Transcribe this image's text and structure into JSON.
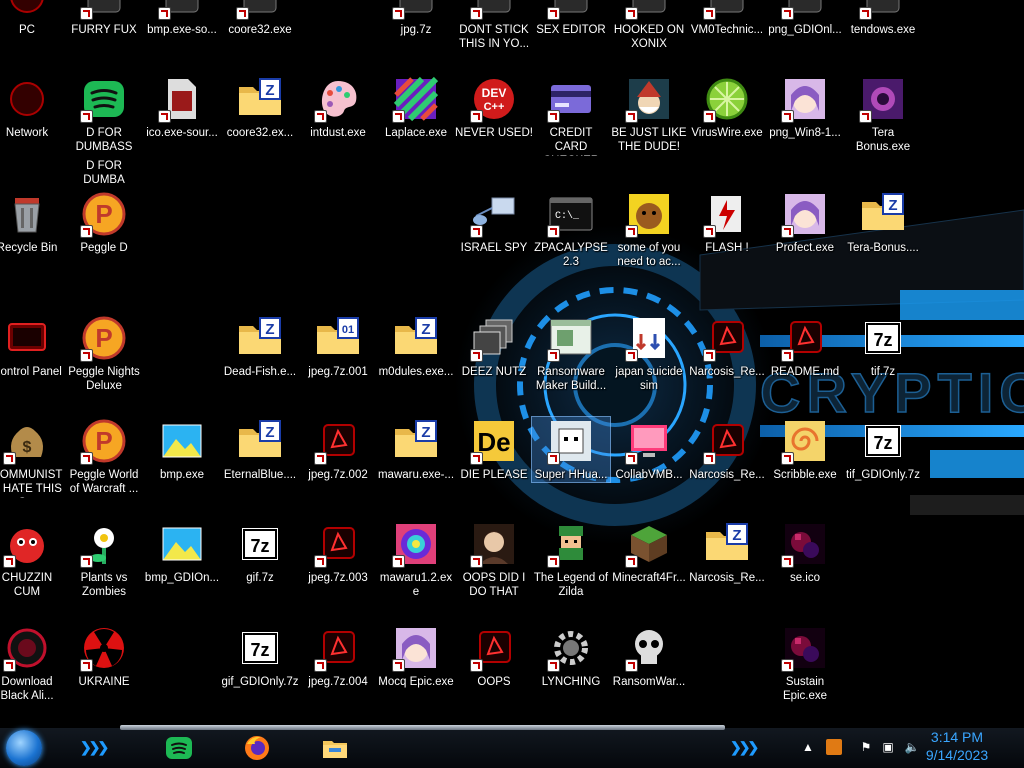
{
  "wallpaper": {
    "logo_text": "CRYPTIC"
  },
  "taskbar": {
    "start_label": "Start",
    "clock_time": "3:14 PM",
    "clock_date": "9/14/2023",
    "pinned": [
      "Spotify",
      "Firefox",
      "File Explorer"
    ]
  },
  "icons": [
    {
      "label": "PC",
      "icon": "computer-icon"
    },
    {
      "label": "FURRY FUX",
      "icon": "app-icon"
    },
    {
      "label": "bmp.exe-so...",
      "icon": "app-icon"
    },
    {
      "label": "coore32.exe",
      "icon": "app-icon"
    },
    {
      "label": "jpg.7z",
      "icon": "archive-icon"
    },
    {
      "label": "DONT STICK THIS IN YO...",
      "icon": "app-icon"
    },
    {
      "label": "SEX EDITOR",
      "icon": "app-icon"
    },
    {
      "label": "HOOKED ON XONIX",
      "icon": "app-icon"
    },
    {
      "label": "VM0Technic...",
      "icon": "app-icon"
    },
    {
      "label": "png_GDIOnl...",
      "icon": "app-icon"
    },
    {
      "label": "tendows.exe",
      "icon": "app-icon"
    },
    {
      "label": "Network",
      "icon": "network-icon"
    },
    {
      "label": "D FOR DUMBASS",
      "icon": "spotify-icon"
    },
    {
      "label": "ico.exe-sour...",
      "icon": "document-icon"
    },
    {
      "label": "coore32.ex...",
      "icon": "zip-folder-icon"
    },
    {
      "label": "intdust.exe",
      "icon": "palette-icon"
    },
    {
      "label": "Laplace.exe",
      "icon": "noise-image-icon"
    },
    {
      "label": "NEVER USED!",
      "icon": "devcpp-icon"
    },
    {
      "label": "CREDIT CARD CHECKER",
      "icon": "credit-card-icon"
    },
    {
      "label": "BE JUST LIKE THE DUDE!",
      "icon": "santa-icon"
    },
    {
      "label": "VirusWire.exe",
      "icon": "lime-icon"
    },
    {
      "label": "png_Win8-1...",
      "icon": "anime-icon"
    },
    {
      "label": "Tera Bonus.exe",
      "icon": "purple-noise-icon"
    },
    {
      "label": "D FOR DUMBA",
      "icon": "text-fragment"
    },
    {
      "label": "Recycle Bin",
      "icon": "recycle-bin-icon"
    },
    {
      "label": "Peggle D",
      "icon": "peggle-icon"
    },
    {
      "label": "ISRAEL SPY",
      "icon": "network-share-icon"
    },
    {
      "label": "ZPACALYPSE 2.3",
      "icon": "terminal-icon"
    },
    {
      "label": "some of you need to ac...",
      "icon": "dog-icon"
    },
    {
      "label": "FLASH !",
      "icon": "flash-icon"
    },
    {
      "label": "Profect.exe",
      "icon": "anime-icon"
    },
    {
      "label": "Tera-Bonus....",
      "icon": "zip-folder-icon"
    },
    {
      "label": "Control Panel",
      "icon": "control-panel-icon"
    },
    {
      "label": "Peggle Nights Deluxe",
      "icon": "peggle-icon"
    },
    {
      "label": "Dead-Fish.e...",
      "icon": "zip-folder-icon"
    },
    {
      "label": "jpeg.7z.001",
      "icon": "split-folder-icon"
    },
    {
      "label": "m0dules.exe...",
      "icon": "zip-folder-icon"
    },
    {
      "label": "DEEZ NUTZ",
      "icon": "windows-stack-icon"
    },
    {
      "label": "Ransomware Maker Build...",
      "icon": "window-icon"
    },
    {
      "label": "japan suicide sim",
      "icon": "installer-icon"
    },
    {
      "label": "Narcosis_Re...",
      "icon": "red-glow-icon"
    },
    {
      "label": "README.md",
      "icon": "red-glow-icon"
    },
    {
      "label": "tif.7z",
      "icon": "7z-icon"
    },
    {
      "label": "COMMUNISTS HATE THIS G...",
      "icon": "money-bag-icon"
    },
    {
      "label": "Peggle World of Warcraft ...",
      "icon": "peggle-icon"
    },
    {
      "label": "bmp.exe",
      "icon": "image-icon"
    },
    {
      "label": "EternalBlue....",
      "icon": "zip-folder-icon"
    },
    {
      "label": "jpeg.7z.002",
      "icon": "red-glow-icon"
    },
    {
      "label": "mawaru.exe-...",
      "icon": "zip-folder-icon"
    },
    {
      "label": "DIE PLEASE",
      "icon": "dev-eco-icon"
    },
    {
      "label": "Super HHua...",
      "icon": "pixel-cat-icon"
    },
    {
      "label": "CollabVMB...",
      "icon": "monitor-icon"
    },
    {
      "label": "Narcosis_Re...",
      "icon": "red-glow-icon"
    },
    {
      "label": "Scribble.exe",
      "icon": "swirl-icon"
    },
    {
      "label": "tif_GDIOnly.7z",
      "icon": "7z-icon"
    },
    {
      "label": "CHUZZIN CUM",
      "icon": "chuzzle-icon"
    },
    {
      "label": "Plants vs Zombies",
      "icon": "pvz-icon"
    },
    {
      "label": "bmp_GDIOn...",
      "icon": "image-icon"
    },
    {
      "label": "gif.7z",
      "icon": "7z-icon"
    },
    {
      "label": "jpeg.7z.003",
      "icon": "red-glow-icon"
    },
    {
      "label": "mawaru1.2.exe",
      "icon": "psychedelic-icon"
    },
    {
      "label": "OOPS DID I DO THAT",
      "icon": "portrait-icon"
    },
    {
      "label": "The Legend of Zilda",
      "icon": "pixel-hero-icon"
    },
    {
      "label": "Minecraft4Fr...",
      "icon": "grass-block-icon"
    },
    {
      "label": "Narcosis_Re...",
      "icon": "zip-folder-icon"
    },
    {
      "label": "se.ico",
      "icon": "dark-noise-icon"
    },
    {
      "label": "Download Black Ali...",
      "icon": "black-orb-icon"
    },
    {
      "label": "UKRAINE",
      "icon": "radiation-icon"
    },
    {
      "label": "gif_GDIOnly.7z",
      "icon": "7z-icon"
    },
    {
      "label": "jpeg.7z.004",
      "icon": "red-glow-icon"
    },
    {
      "label": "Mocq Epic.exe",
      "icon": "anime-icon"
    },
    {
      "label": "OOPS",
      "icon": "red-glow-icon"
    },
    {
      "label": "LYNCHING",
      "icon": "gear-icon"
    },
    {
      "label": "RansomWar...",
      "icon": "skull-icon"
    },
    {
      "label": "Sustain Epic.exe",
      "icon": "dark-noise-icon"
    }
  ]
}
